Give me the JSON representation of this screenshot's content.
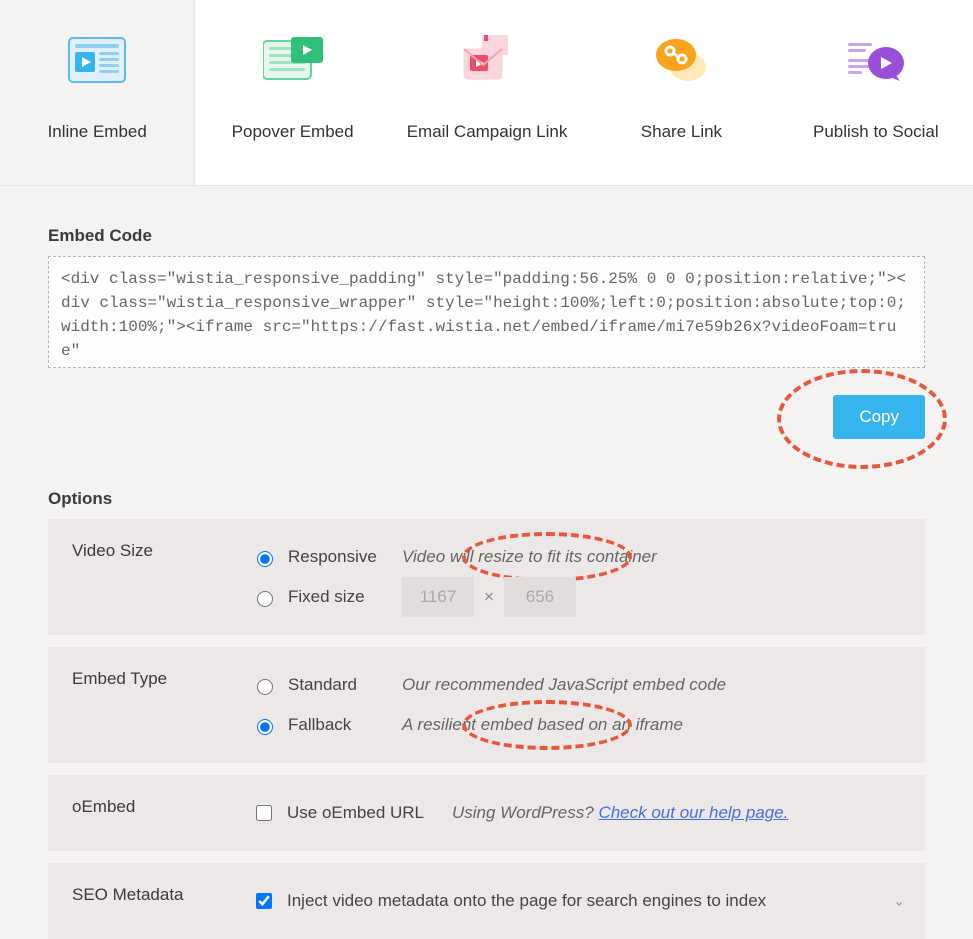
{
  "tabs": [
    {
      "label": "Inline Embed",
      "active": true
    },
    {
      "label": "Popover Embed",
      "active": false
    },
    {
      "label": "Email Campaign Link",
      "active": false
    },
    {
      "label": "Share Link",
      "active": false
    },
    {
      "label": "Publish to Social",
      "active": false
    }
  ],
  "embed": {
    "title": "Embed Code",
    "code": "<div class=\"wistia_responsive_padding\" style=\"padding:56.25% 0 0 0;position:relative;\"><div class=\"wistia_responsive_wrapper\" style=\"height:100%;left:0;position:absolute;top:0;width:100%;\"><iframe src=\"https://fast.wistia.net/embed/iframe/mi7e59b26x?videoFoam=true\"",
    "copy_label": "Copy"
  },
  "options": {
    "title": "Options",
    "video_size": {
      "label": "Video Size",
      "responsive": {
        "label": "Responsive",
        "desc": "Video will resize to fit its container",
        "checked": true
      },
      "fixed": {
        "label": "Fixed size",
        "width": "1167",
        "height": "656",
        "checked": false
      }
    },
    "embed_type": {
      "label": "Embed Type",
      "standard": {
        "label": "Standard",
        "desc": "Our recommended JavaScript embed code",
        "checked": false
      },
      "fallback": {
        "label": "Fallback",
        "desc": "A resilient embed based on an iframe",
        "checked": true
      }
    },
    "oembed": {
      "label": "oEmbed",
      "check_label": "Use oEmbed URL",
      "desc_prefix": "Using WordPress? ",
      "link_text": "Check out our help page.",
      "checked": false
    },
    "seo": {
      "label": "SEO Metadata",
      "check_label": "Inject video metadata onto the page for search engines to index",
      "checked": true
    }
  }
}
